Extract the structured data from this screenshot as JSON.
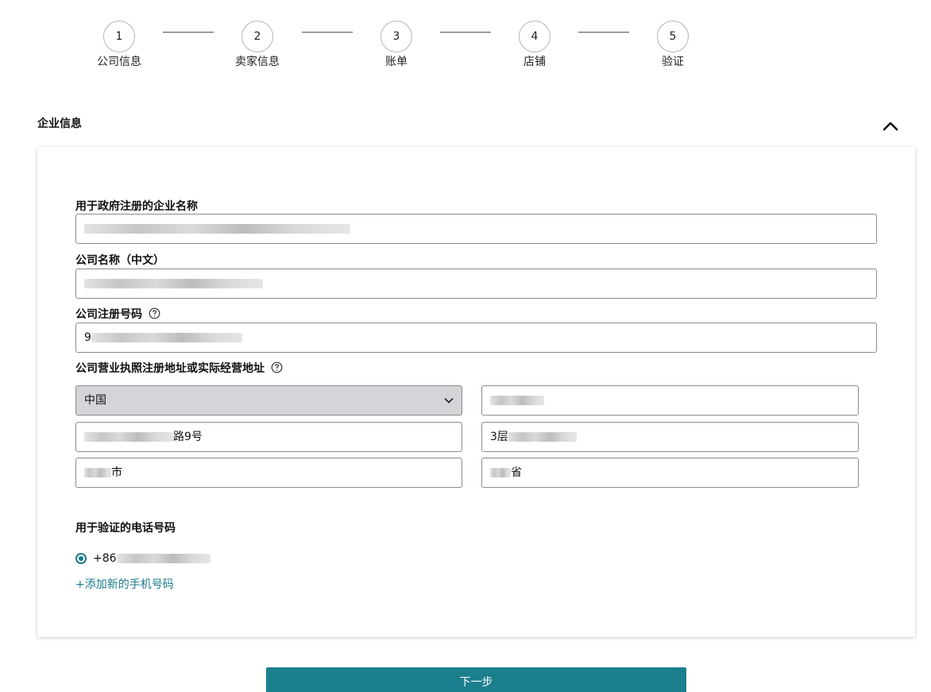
{
  "stepper": {
    "steps": [
      {
        "number": "1",
        "label": "公司信息"
      },
      {
        "number": "2",
        "label": "卖家信息"
      },
      {
        "number": "3",
        "label": "账单"
      },
      {
        "number": "4",
        "label": "店铺"
      },
      {
        "number": "5",
        "label": "验证"
      }
    ]
  },
  "section": {
    "title": "企业信息",
    "toggle_icon": "chevron-up-icon"
  },
  "form": {
    "business_name_label": "用于政府注册的企业名称",
    "business_name_value": "",
    "company_name_cn_label": "公司名称（中文）",
    "company_name_cn_value": "",
    "registration_number_label": "公司注册号码",
    "registration_number_value": "9",
    "address_label": "公司营业执照注册地址或实际经营地址",
    "address": {
      "country": "中国",
      "postal_code": "",
      "address_line1": "路9号",
      "address_line2": "3层",
      "city": "市",
      "province": "省"
    },
    "phone_label": "用于验证的电话号码",
    "phone_value": "+86",
    "add_phone_link": "+添加新的手机号码"
  },
  "next_button_label": "下一步",
  "colors": {
    "accent": "#1b7f8e",
    "select_bg": "#d4d5d8",
    "border": "#8c8c8c"
  }
}
